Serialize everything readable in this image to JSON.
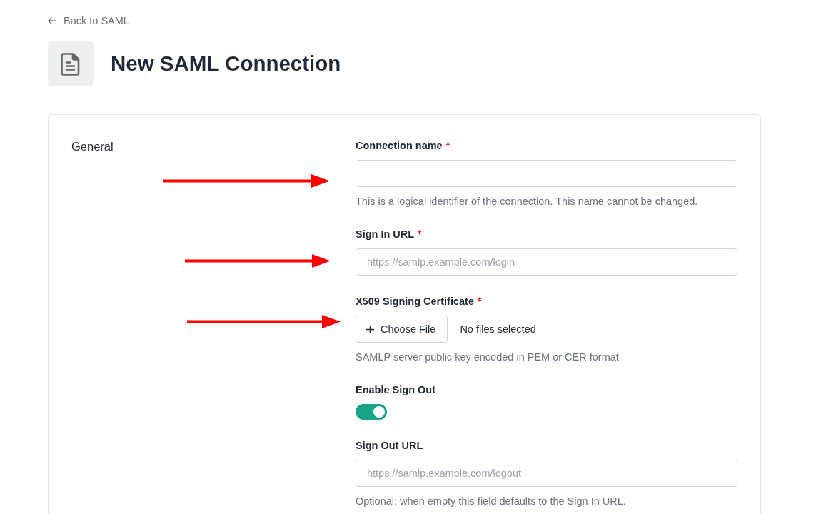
{
  "back_link": {
    "label": "Back to SAML"
  },
  "page": {
    "title": "New SAML Connection"
  },
  "section": {
    "title": "General",
    "fields": [
      {
        "kind": "text",
        "label": "Connection name",
        "required": true,
        "arrow": true,
        "help": "This is a logical identifier of the connection. This name cannot be changed."
      },
      {
        "kind": "text",
        "label": "Sign In URL",
        "required": true,
        "arrow": true,
        "placeholder": "https://samlp.example.com/login"
      },
      {
        "kind": "file",
        "label": "X509 Signing Certificate",
        "required": true,
        "arrow": true,
        "button": "Choose File",
        "file_status": "No files selected",
        "help": "SAMLP server public key encoded in PEM or CER format"
      },
      {
        "kind": "toggle",
        "label": "Enable Sign Out",
        "required": false,
        "arrow": false,
        "on": true
      },
      {
        "kind": "text",
        "label": "Sign Out URL",
        "required": false,
        "arrow": false,
        "placeholder": "https://samlp.example.com/logout",
        "help": "Optional: when empty this field defaults to the Sign In URL."
      }
    ]
  }
}
